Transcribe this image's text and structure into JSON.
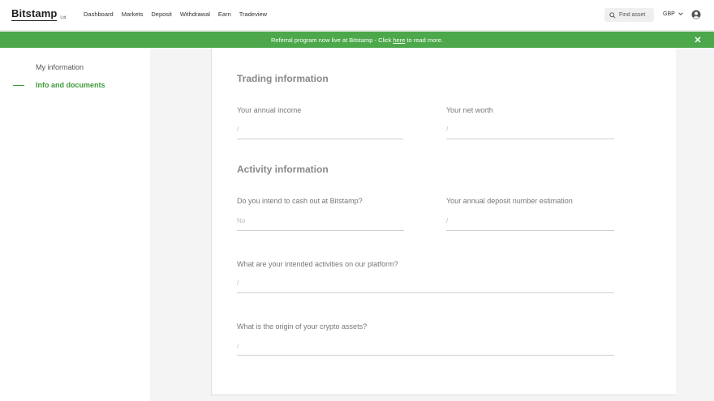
{
  "header": {
    "brand": "Bitstamp",
    "brand_suffix": "Ltd",
    "nav": [
      "Dashboard",
      "Markets",
      "Deposit",
      "Withdrawal",
      "Earn",
      "Tradeview"
    ],
    "search_placeholder": "Find asset",
    "currency": "GBP"
  },
  "banner": {
    "text_before": "Referral program now live at Bitstamp - Click",
    "link": "here",
    "text_after": "to read more.",
    "color": "#4ca84a"
  },
  "sidebar": {
    "items": [
      {
        "label": "My information",
        "active": false
      },
      {
        "label": "Info and documents",
        "active": true
      }
    ],
    "accent": "#3e9a3b"
  },
  "sections": [
    {
      "title": "Trading information",
      "fields": [
        {
          "label": "Your annual income",
          "value": "/"
        },
        {
          "label": "Your net worth",
          "value": "/"
        }
      ]
    },
    {
      "title": "Activity information",
      "fields": [
        {
          "label": "Do you intend to cash out at Bitstamp?",
          "value": "No"
        },
        {
          "label": "Your annual deposit number estimation",
          "value": "/"
        },
        {
          "label": "What are your intended activities on our platform?",
          "value": "/"
        },
        {
          "label": "What is the origin of your crypto assets?",
          "value": "/"
        }
      ]
    }
  ]
}
